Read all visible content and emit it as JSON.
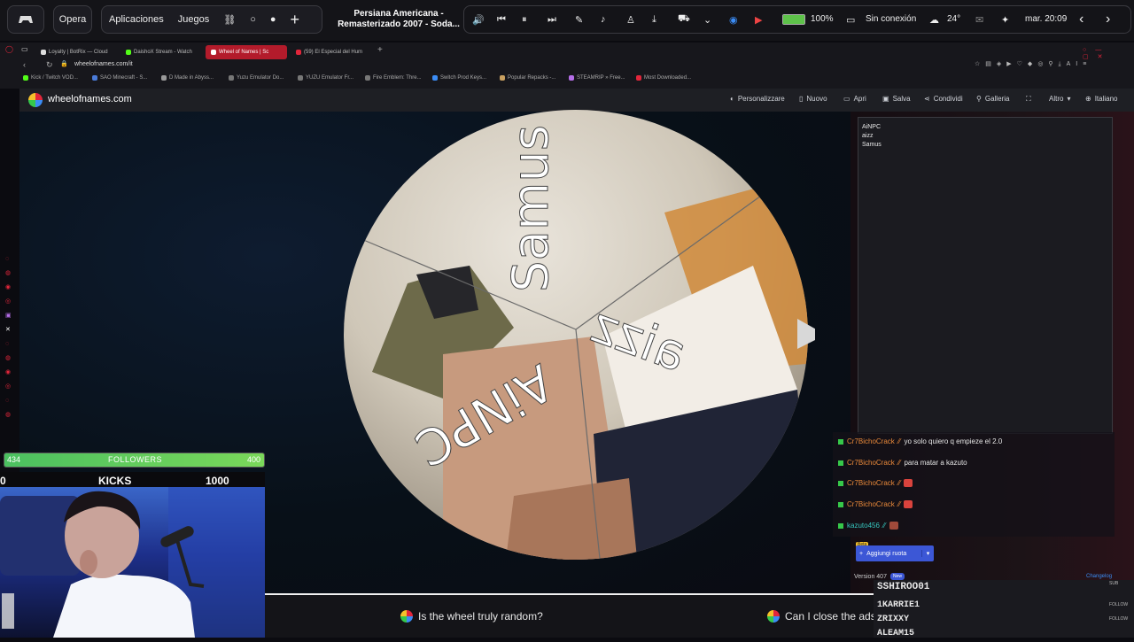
{
  "osbar": {
    "opera_label": "Opera",
    "apps_label": "Aplicaciones",
    "games_label": "Juegos",
    "media_title_1": "Persiana Americana -",
    "media_title_2": "Remasterizado 2007 - Soda...",
    "battery": "100%",
    "network": "Sin conexión",
    "temperature": "24°",
    "clock": "mar. 20:09"
  },
  "browser": {
    "tabs": [
      "Loyalty | BotRix — Cloud",
      "DaishoX Stream - Watch",
      "Wheel of Names | Sc",
      "(59) El Especial del Hum"
    ],
    "url": "wheelofnames.com/it",
    "bookmarks": [
      "Kick / Twitch VOD...",
      "SAO Minecraft - S...",
      "D Made in Abyss...",
      "Yuzu Emulator Do...",
      "YUZU Emulator Fr...",
      "Fire Emblem: Thre...",
      "Switch Prod Keys...",
      "Popular Repacks -...",
      "STEAMRIP » Free...",
      "Most Downloaded..."
    ]
  },
  "site": {
    "brand": "wheelofnames.com",
    "nav": [
      "Personalizzare",
      "Nuovo",
      "Apri",
      "Salva",
      "Condividi",
      "Galleria",
      "Altro",
      "Italiano"
    ]
  },
  "wheel": {
    "segments": [
      "Samus",
      "aizz",
      "AiNPC"
    ]
  },
  "entries": [
    "AiNPC",
    "aizz",
    "Samus"
  ],
  "add_image_button": "Aggiungi ruota",
  "version": "Version 407",
  "version_badge": "New",
  "changelog": "Changelog",
  "beta_badge": "Beta",
  "chat": [
    {
      "user": "Cr7BichoCrack",
      "text": "yo solo quiero q empieze el 2.0",
      "emote": false
    },
    {
      "user": "Cr7BichoCrack",
      "text": "para matar a kazuto",
      "emote": false
    },
    {
      "user": "Cr7BichoCrack",
      "text": "",
      "emote": true
    },
    {
      "user": "Cr7BichoCrack",
      "text": "",
      "emote": true
    },
    {
      "user": "kazuto456",
      "text": "",
      "emote": true
    }
  ],
  "overlay": {
    "followers_current": "434",
    "followers_label": "FOLLOWERS",
    "followers_goal": "400",
    "kicks_current": "0",
    "kicks_label": "KICKS",
    "kicks_goal": "1000",
    "followers_progress": 1.0
  },
  "faq": [
    "Is the wheel truly random?",
    "Can I close the ads"
  ],
  "subs": {
    "header_tag": "SUB",
    "rows": [
      {
        "name": "SSHIROO01",
        "tag": ""
      },
      {
        "name": "1KARRIE1",
        "tag": "FOLLOW"
      },
      {
        "name": "ZRIXXY",
        "tag": "FOLLOW"
      },
      {
        "name": "ALEAM15",
        "tag": ""
      }
    ]
  },
  "colors": {
    "accent_green": "#36c84a",
    "brand_red": "#e2263b",
    "button_blue": "#3c57d6"
  }
}
